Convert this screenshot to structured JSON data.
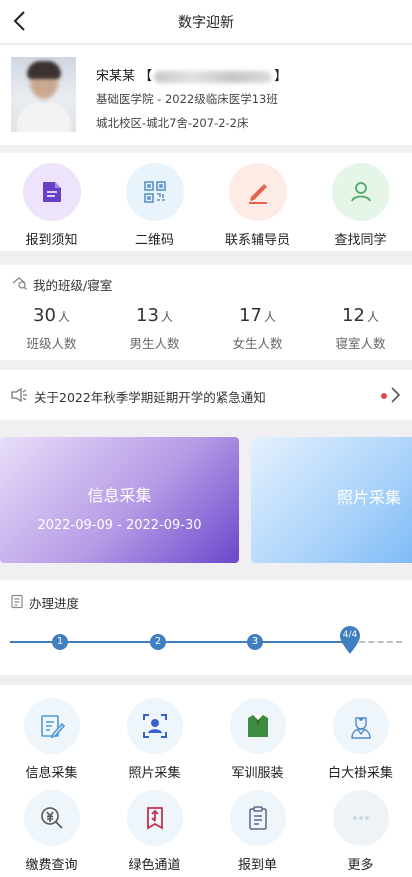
{
  "header": {
    "title": "数字迎新"
  },
  "profile": {
    "name": "宋某某",
    "bracket_open": "【",
    "bracket_close": "】",
    "college": "基础医学院 - 2022级临床医学13班",
    "dorm": "城北校区-城北7舍-207-2-2床"
  },
  "quick_actions": [
    {
      "label": "报到须知",
      "icon": "document-icon",
      "bg": "#ede4fb"
    },
    {
      "label": "二维码",
      "icon": "qr-code-icon",
      "bg": "#e8f3fb"
    },
    {
      "label": "联系辅导员",
      "icon": "pencil-icon",
      "bg": "#fdebe6"
    },
    {
      "label": "查找同学",
      "icon": "person-icon",
      "bg": "#e5f6e8"
    }
  ],
  "class_info": {
    "title": "我的班级/寝室",
    "stats": [
      {
        "value": "30",
        "unit": "人",
        "label": "班级人数"
      },
      {
        "value": "13",
        "unit": "人",
        "label": "男生人数"
      },
      {
        "value": "17",
        "unit": "人",
        "label": "女生人数"
      },
      {
        "value": "12",
        "unit": "人",
        "label": "寝室人数"
      }
    ]
  },
  "notice": {
    "text": "关于2022年秋季学期延期开学的紧急通知"
  },
  "banners": [
    {
      "title": "信息采集",
      "dates": "2022-09-09 - 2022-09-30"
    },
    {
      "title": "照片采集"
    }
  ],
  "progress": {
    "title": "办理进度",
    "steps": [
      "1",
      "2",
      "3"
    ],
    "current": "4/4"
  },
  "services": [
    {
      "label": "信息采集",
      "icon": "form-edit-icon"
    },
    {
      "label": "照片采集",
      "icon": "portrait-scan-icon"
    },
    {
      "label": "军训服装",
      "icon": "uniform-icon"
    },
    {
      "label": "白大褂采集",
      "icon": "doctor-icon"
    },
    {
      "label": "缴费查询",
      "icon": "payment-search-icon"
    },
    {
      "label": "绿色通道",
      "icon": "green-channel-icon"
    },
    {
      "label": "报到单",
      "icon": "clipboard-icon"
    },
    {
      "label": "更多",
      "icon": "more-icon"
    }
  ]
}
